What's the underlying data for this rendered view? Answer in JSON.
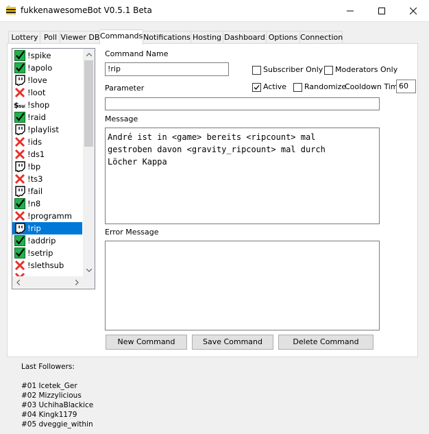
{
  "window": {
    "title": "fukkenawesomeBot V0.5.1 Beta"
  },
  "tabs": [
    "Lottery",
    "Poll",
    "Viewer DB",
    "Commands",
    "Notifications",
    "Hosting",
    "Dashboard",
    "Options",
    "Connection"
  ],
  "commands": [
    {
      "name": "!spike",
      "icon": "check-icon"
    },
    {
      "name": "!apolo",
      "icon": "check-icon"
    },
    {
      "name": "!love",
      "icon": "twitch-icon"
    },
    {
      "name": "!loot",
      "icon": "cross-icon"
    },
    {
      "name": "!shop",
      "icon": "sub-icon"
    },
    {
      "name": "!raid",
      "icon": "check-icon"
    },
    {
      "name": "!playlist",
      "icon": "twitch-icon"
    },
    {
      "name": "!ids",
      "icon": "cross-icon"
    },
    {
      "name": "!ds1",
      "icon": "cross-icon"
    },
    {
      "name": "!bp",
      "icon": "twitch-icon"
    },
    {
      "name": "!ts3",
      "icon": "cross-icon"
    },
    {
      "name": "!fail",
      "icon": "twitch-icon"
    },
    {
      "name": "!n8",
      "icon": "check-icon"
    },
    {
      "name": "!programm",
      "icon": "cross-icon"
    },
    {
      "name": "!rip",
      "icon": "twitch-icon"
    },
    {
      "name": "!addrip",
      "icon": "check-icon"
    },
    {
      "name": "!setrip",
      "icon": "check-icon"
    },
    {
      "name": "!slethsub",
      "icon": "cross-icon"
    },
    {
      "name": "",
      "icon": "cross-icon"
    }
  ],
  "selected_index": 14,
  "form": {
    "command_name_label": "Command Name",
    "command_name_value": "!rip",
    "subscriber_only_label": "Subscriber Only",
    "subscriber_only": false,
    "moderators_only_label": "Moderators Only",
    "moderators_only": false,
    "parameter_label": "Parameter",
    "parameter_value": "",
    "active_label": "Active",
    "active": true,
    "randomize_label": "Randomize",
    "randomize": false,
    "cooldown_label": "Cooldown Time",
    "cooldown_value": "60",
    "message_label": "Message",
    "message_value": "André ist in <game> bereits <ripcount> mal\ngestroben davon <gravity_ripcount> mal durch\nLöcher Kappa",
    "error_label": "Error Message",
    "error_value": ""
  },
  "buttons": {
    "new": "New Command",
    "save": "Save Command",
    "delete": "Delete Command"
  },
  "followers": {
    "label": "Last Followers:",
    "list": [
      "#01 Icetek_Ger",
      "#02 Mizzylicious",
      "#03 UchihaBlackice",
      "#04 Kingk1179",
      "#05 dveggie_within"
    ]
  },
  "colors": {
    "selection": "#0078d7",
    "check": "#22b14c",
    "cross": "#e8302a"
  }
}
